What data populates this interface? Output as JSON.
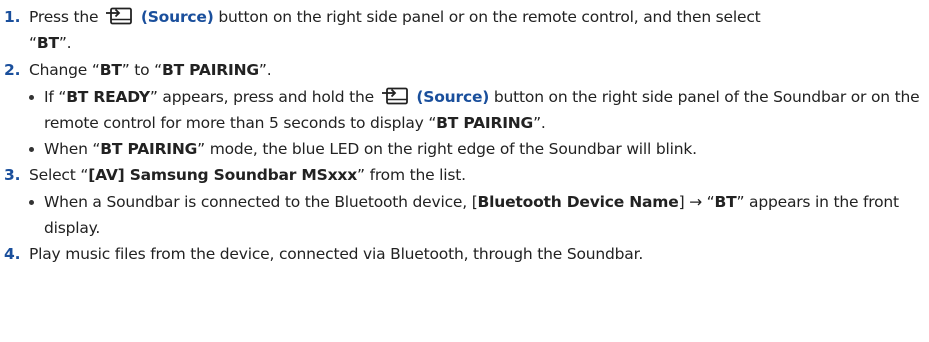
{
  "steps": [
    {
      "number": "1.",
      "t1": "Press the",
      "source_label": "(Source)",
      "t2": "button on the right side panel or on the remote control, and then select",
      "q_open": "“",
      "bt": "BT",
      "q_close": "”."
    },
    {
      "number": "2.",
      "t1": "Change “",
      "bt": "BT",
      "t2": "” to “",
      "bt_pairing": "BT PAIRING",
      "t3": "”."
    },
    {
      "number": "3.",
      "t1": "Select “",
      "device": "[AV] Samsung Soundbar MSxxx",
      "t2": "” from the list."
    },
    {
      "number": "4.",
      "t1": "Play music files from the device, connected via Bluetooth, through the Soundbar."
    }
  ],
  "step2_bullets": [
    {
      "t1": "If “",
      "bt_ready": "BT READY",
      "t2": "” appears, press and hold the",
      "source_label": "(Source)",
      "t3": "button on the right side panel of the Soundbar or on the remote control for more than 5 seconds to display “",
      "bt_pairing": "BT PAIRING",
      "t4": "”."
    },
    {
      "t1": "When “",
      "bt_pairing": "BT PAIRING",
      "t2": "” mode, the blue LED on the right edge of the Soundbar will blink."
    }
  ],
  "step3_bullets": [
    {
      "t1": "When a Soundbar is connected to the Bluetooth device, [",
      "device_name": "Bluetooth Device Name",
      "t2": "] → “",
      "bt": "BT",
      "t3": "” appears in the front display."
    }
  ],
  "icons": {
    "source": "source-input-icon"
  },
  "colors": {
    "text": "#222222",
    "accent": "#1a4f9c"
  }
}
